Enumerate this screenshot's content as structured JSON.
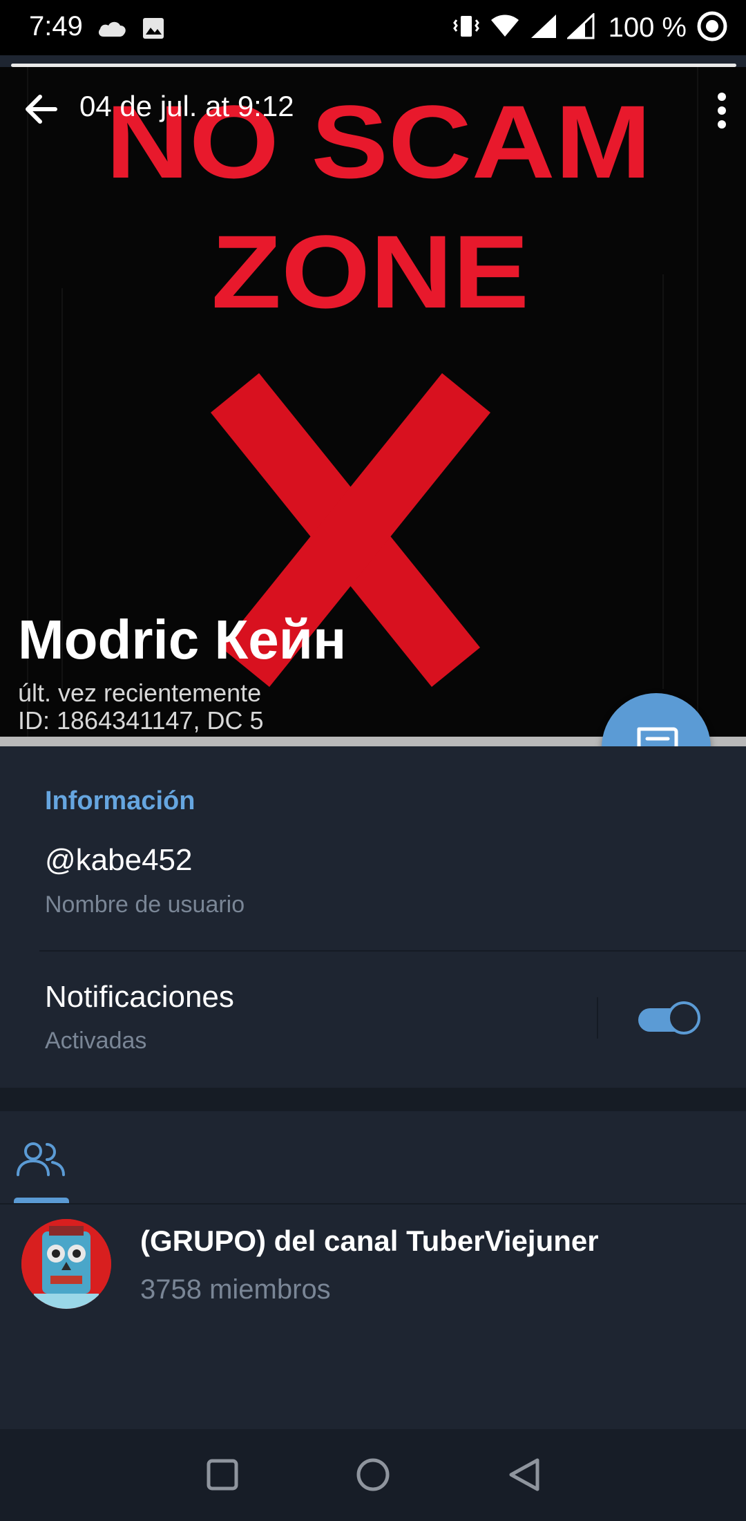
{
  "status_bar": {
    "time": "7:49",
    "battery": "100 %",
    "icons": [
      "cloud-icon",
      "image-icon",
      "vibrate-icon",
      "wifi-icon",
      "signal-icon",
      "signal-icon",
      "data-saver-icon"
    ]
  },
  "header": {
    "title": "04 de jul. at 9:12",
    "back_icon": "arrow-left-icon",
    "menu_icon": "more-vertical-icon",
    "photo_text_line1": "NO SCAM",
    "photo_text_line2": "ZONE"
  },
  "profile": {
    "name": "Modric Кейн",
    "status": "últ. vez recientemente",
    "id_line": "ID: 1864341147, DC 5"
  },
  "fab": {
    "icon": "message-icon"
  },
  "info": {
    "section_title": "Información",
    "username": "@kabe452",
    "username_caption": "Nombre de usuario",
    "notifications_title": "Notificaciones",
    "notifications_caption": "Activadas",
    "notifications_enabled": true
  },
  "members": {
    "tab_icon": "members-icon",
    "groups": [
      {
        "name": "(GRUPO) del canal TuberViejuner",
        "count": "3758 miembros"
      }
    ]
  },
  "nav": {
    "icons": [
      "recents-square-icon",
      "home-circle-icon",
      "back-triangle-icon"
    ]
  },
  "colors": {
    "accent": "#5b9bd5",
    "background": "#1e2531",
    "photo_red": "#e8192c"
  }
}
